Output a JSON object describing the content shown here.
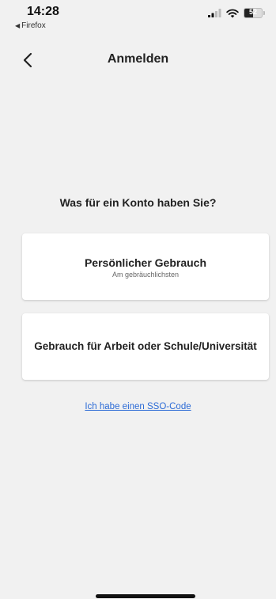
{
  "status_bar": {
    "time": "14:28",
    "back_app": "Firefox",
    "battery": "52",
    "battery_level": 0.52,
    "icons": [
      "signal-icon",
      "wifi-icon",
      "battery-icon"
    ]
  },
  "header": {
    "title": "Anmelden",
    "back_icon": "chevron-left-icon"
  },
  "question": "Was für ein Konto haben Sie?",
  "options": [
    {
      "title": "Persönlicher Gebrauch",
      "subtitle": "Am gebräuchlichsten"
    },
    {
      "title": "Gebrauch für Arbeit oder Schule/Universität"
    }
  ],
  "sso_link": "Ich habe einen SSO-Code",
  "colors": {
    "background": "#f1f1f1",
    "card": "#ffffff",
    "link": "#2c6bd6"
  }
}
